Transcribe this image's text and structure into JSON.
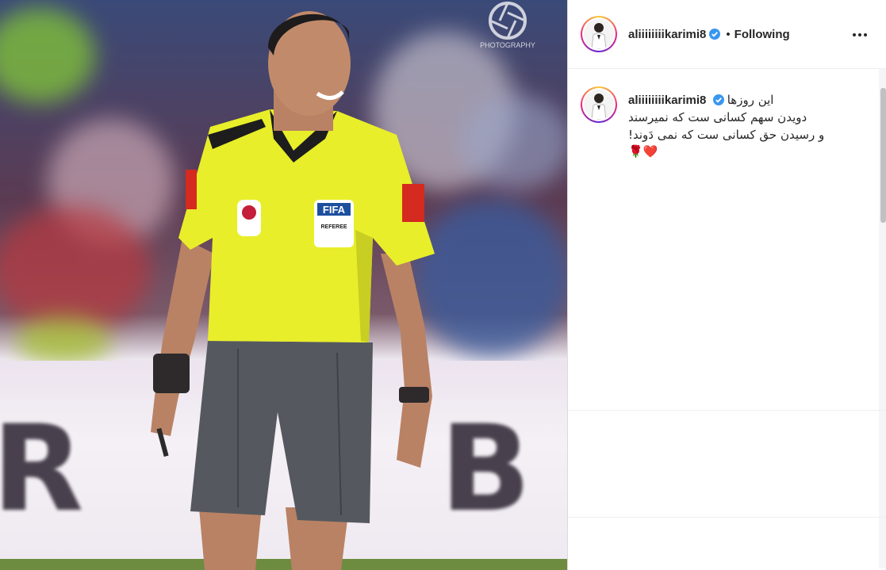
{
  "post": {
    "author": {
      "username": "aliiiiiiiikarimi8",
      "verified": true,
      "follow_state": "Following",
      "avatar_icon": "person-avatar"
    },
    "header": {
      "separator": "•",
      "more_icon": "more-options-icon"
    },
    "caption": {
      "username": "aliiiiiiiikarimi8",
      "lines": [
        "این روزها",
        "دویدن سهم کسانی ست که نمیرسند",
        "و رسیدن حق کسانی ست که نمی دَوند!"
      ],
      "emojis": [
        "🌹",
        "❤️"
      ]
    },
    "media": {
      "image": "referee-photo",
      "watermark_icon": "camera-shutter-watermark"
    },
    "colors": {
      "verified_blue": "#3897f0",
      "text_primary": "#262626",
      "border": "#dbdbdb",
      "jersey_yellow": "#e8ee2a",
      "shorts_gray": "#55595f"
    }
  }
}
